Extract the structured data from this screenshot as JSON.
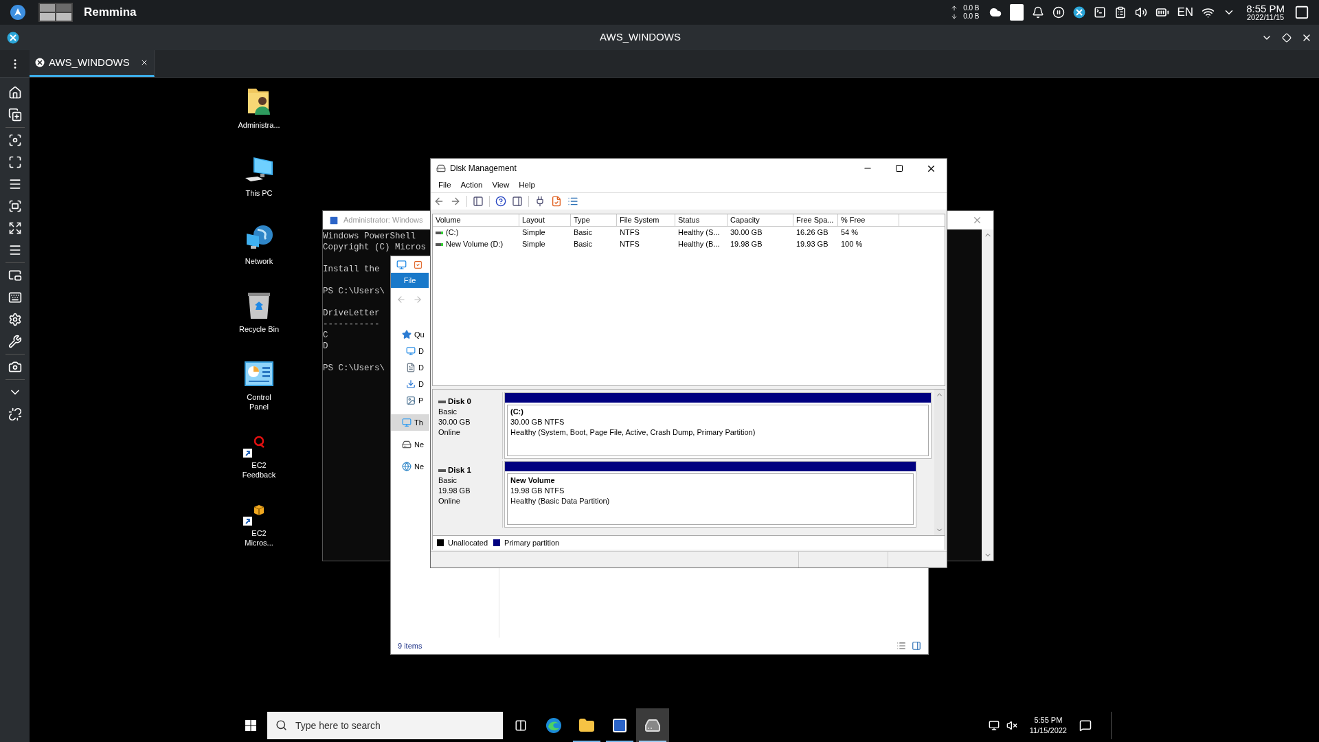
{
  "top_panel": {
    "app_name": "Remmina",
    "net_up": "0.0 B",
    "net_down": "0.0 B",
    "language": "EN",
    "time": "8:55 PM",
    "date": "2022/11/15"
  },
  "remmina": {
    "title": "AWS_WINDOWS",
    "tabs": [
      {
        "label": "AWS_WINDOWS",
        "selected": true
      }
    ]
  },
  "desktop_icons": [
    {
      "label": "Administra...",
      "kind": "folder",
      "shortcut": false
    },
    {
      "label": "This PC",
      "kind": "computer",
      "shortcut": false
    },
    {
      "label": "Network",
      "kind": "network",
      "shortcut": false
    },
    {
      "label": "Recycle Bin",
      "kind": "bin",
      "shortcut": false
    },
    {
      "label": "Control Panel",
      "kind": "panel",
      "shortcut": false
    },
    {
      "label": "EC2 Feedback",
      "kind": "feedback",
      "shortcut": true
    },
    {
      "label": "EC2 Micros...",
      "kind": "package",
      "shortcut": true
    }
  ],
  "powershell": {
    "title": "Administrator: Windows",
    "blocks": [
      [
        "Windows PowerShell",
        "Copyright (C) Micros"
      ],
      [
        "Install the"
      ],
      [
        "PS C:\\Users\\"
      ],
      [
        "DriveLetter",
        "-----------",
        "C",
        "D"
      ],
      [
        "PS C:\\Users\\"
      ]
    ]
  },
  "explorer": {
    "file_tab": "File",
    "nav": [
      {
        "label": "Qu",
        "kind": "star",
        "selected": false,
        "children": [
          {
            "label": "D",
            "kind": "desktop",
            "selected": false
          },
          {
            "label": "D",
            "kind": "document",
            "selected": false
          },
          {
            "label": "D",
            "kind": "download",
            "selected": false
          },
          {
            "label": "P",
            "kind": "pictures",
            "selected": false
          }
        ]
      },
      {
        "label": "Th",
        "kind": "pc",
        "selected": true
      },
      {
        "label": "Ne",
        "kind": "drive",
        "selected": false
      },
      {
        "label": "Ne",
        "kind": "network",
        "selected": false
      }
    ],
    "status": "9 items"
  },
  "disk_management": {
    "title": "Disk Management",
    "menus": [
      "File",
      "Action",
      "View",
      "Help"
    ],
    "columns": [
      "Volume",
      "Layout",
      "Type",
      "File System",
      "Status",
      "Capacity",
      "Free Spa...",
      "% Free"
    ],
    "rows": [
      [
        "(C:)",
        "Simple",
        "Basic",
        "NTFS",
        "Healthy (S...",
        "30.00 GB",
        "16.26 GB",
        "54 %"
      ],
      [
        "New Volume (D:)",
        "Simple",
        "Basic",
        "NTFS",
        "Healthy (B...",
        "19.98 GB",
        "19.93 GB",
        "100 %"
      ]
    ],
    "disks": [
      {
        "name": "Disk 0",
        "type": "Basic",
        "size": "30.00 GB",
        "status": "Online",
        "partition": {
          "name": "(C:)",
          "size": "30.00 GB NTFS",
          "health": "Healthy (System, Boot, Page File, Active, Crash Dump, Primary Partition)"
        }
      },
      {
        "name": "Disk 1",
        "type": "Basic",
        "size": "19.98 GB",
        "status": "Online",
        "partition": {
          "name": "New Volume",
          "size": "19.98 GB NTFS",
          "health": "Healthy (Basic Data Partition)"
        }
      }
    ],
    "legend": [
      {
        "label": "Unallocated",
        "color": "#000000"
      },
      {
        "label": "Primary partition",
        "color": "#000080"
      }
    ]
  },
  "taskbar": {
    "search_placeholder": "Type here to search",
    "apps": [
      {
        "kind": "taskview",
        "running": false,
        "selected": false
      },
      {
        "kind": "edge",
        "running": false,
        "selected": false
      },
      {
        "kind": "explorer",
        "running": true,
        "selected": false
      },
      {
        "kind": "powershell",
        "running": true,
        "selected": false
      },
      {
        "kind": "diskmgmt",
        "running": true,
        "selected": true
      }
    ],
    "time": "5:55 PM",
    "date": "11/15/2022"
  }
}
